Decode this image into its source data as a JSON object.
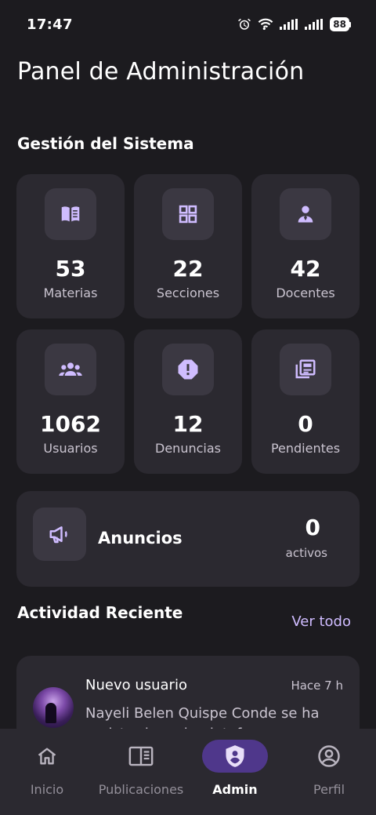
{
  "status_bar": {
    "time": "17:47",
    "battery": "88",
    "icons": [
      "alarm-icon",
      "wifi-icon",
      "signal-icon",
      "signal-icon",
      "battery-icon"
    ]
  },
  "header": {
    "title": "Panel de Administración"
  },
  "system": {
    "title": "Gestión del Sistema",
    "cards": [
      {
        "icon": "book-icon",
        "value": "53",
        "label": "Materias"
      },
      {
        "icon": "grid-icon",
        "value": "22",
        "label": "Secciones"
      },
      {
        "icon": "teacher-icon",
        "value": "42",
        "label": "Docentes"
      },
      {
        "icon": "users-icon",
        "value": "1062",
        "label": "Usuarios"
      },
      {
        "icon": "report-icon",
        "value": "12",
        "label": "Denuncias"
      },
      {
        "icon": "newspaper-icon",
        "value": "0",
        "label": "Pendientes"
      }
    ]
  },
  "announcements": {
    "icon": "megaphone-icon",
    "title": "Anuncios",
    "count": "0",
    "sub": "activos"
  },
  "recent": {
    "title": "Actividad Reciente",
    "see_all": "Ver todo",
    "items": [
      {
        "title": "Nuevo usuario",
        "time": "Hace 7 h",
        "description": "Nayeli Belen Quispe Conde se ha registrado en la plataforma"
      }
    ]
  },
  "nav": {
    "items": [
      {
        "icon": "home-icon",
        "label": "Inicio",
        "active": false
      },
      {
        "icon": "article-icon",
        "label": "Publicaciones",
        "active": false
      },
      {
        "icon": "admin-shield-icon",
        "label": "Admin",
        "active": true
      },
      {
        "icon": "profile-icon",
        "label": "Perfil",
        "active": false
      }
    ]
  },
  "colors": {
    "background": "#1c1b1f",
    "surface": "#2b2930",
    "icon_box": "#3b3842",
    "accent": "#cfbcff",
    "active_pill": "#4f378b"
  }
}
